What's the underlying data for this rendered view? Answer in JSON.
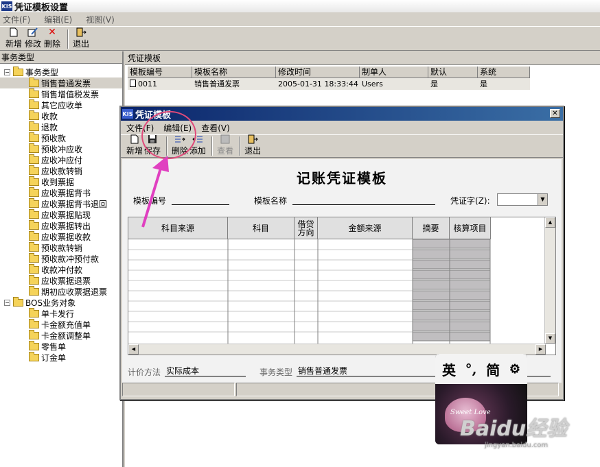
{
  "app": {
    "logo": "KIS",
    "title": "凭证模板设置"
  },
  "menu": [
    "文件(F)",
    "编辑(E)",
    "视图(V)"
  ],
  "toolbar": {
    "new": "新增",
    "edit": "修改",
    "delete": "删除",
    "exit": "退出"
  },
  "left": {
    "header": "事务类型",
    "root1": "事务类型",
    "items": [
      "销售普通发票",
      "销售增值税发票",
      "其它应收单",
      "收款",
      "退款",
      "预收款",
      "预收冲应收",
      "应收冲应付",
      "应收款转销",
      "收到票据",
      "应收票据背书",
      "应收票据背书退回",
      "应收票据贴现",
      "应收票据转出",
      "应收票据收款",
      "预收款转销",
      "预收款冲预付款",
      "收款冲付款",
      "应收票据退票",
      "期初应收票据退票"
    ],
    "root2": "BOS业务对象",
    "items2": [
      "单卡发行",
      "卡金额充值单",
      "卡金额调整单",
      "零售单",
      "订金单"
    ]
  },
  "right": {
    "header": "凭证模板",
    "columns": [
      "模板编号",
      "模板名称",
      "修改时间",
      "制单人",
      "默认",
      "系统"
    ],
    "rows": [
      [
        "0011",
        "销售普通发票",
        "2005-01-31 18:33:44",
        "Users",
        "是",
        "是"
      ]
    ]
  },
  "dialog": {
    "logo": "KIS",
    "title": "凭证模板",
    "close": "✕",
    "menu": [
      "文件(F)",
      "编辑(E)",
      "查看(V)"
    ],
    "toolbar": {
      "new": "新增",
      "save": "保存",
      "delete": "删除",
      "add": "添加",
      "view": "查看",
      "exit": "退出"
    },
    "voucher_title": "记账凭证模板",
    "template_no_label": "模板编号",
    "template_name_label": "模板名称",
    "voucher_word_label": "凭证字(Z):",
    "columns": [
      "科目来源",
      "科目",
      "借贷方向",
      "金额来源",
      "摘要",
      "核算项目"
    ],
    "pricing_label": "计价方法",
    "pricing_value": "实际成本",
    "biz_type_label": "事务类型",
    "biz_type_value": "销售普通发票"
  },
  "ime": {
    "c1": "英",
    "c2": "°,",
    "c3": "简",
    "art_text": "Sweet Love"
  },
  "watermark": {
    "brand": "Baidu经验",
    "url": "jingyan.baidu.com"
  },
  "colors": {
    "title_blue": "#0a246a",
    "annotation": "#e04a7a"
  }
}
